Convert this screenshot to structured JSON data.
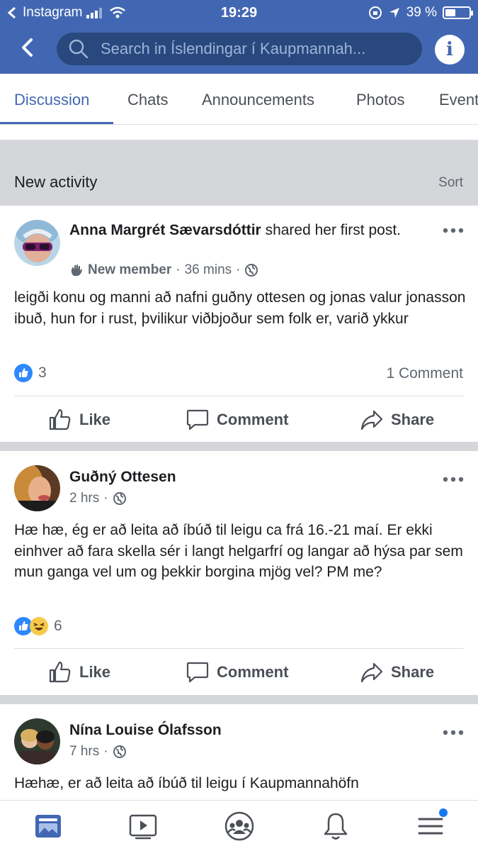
{
  "status_bar": {
    "carrier": "Instagram",
    "time": "19:29",
    "battery": "39 %"
  },
  "header": {
    "search_prefix": "Search in ",
    "search_group": "Íslendingar í Kaupmannah..."
  },
  "tabs": [
    {
      "label": "Discussion",
      "active": true
    },
    {
      "label": "Chats"
    },
    {
      "label": "Announcements"
    },
    {
      "label": "Photos"
    },
    {
      "label": "Event"
    }
  ],
  "activity": {
    "title": "New activity",
    "sort": "Sort"
  },
  "posts": [
    {
      "author": "Anna Margrét Sævarsdóttir",
      "action": " shared her first post.",
      "badge": "New member",
      "time": "36 mins",
      "text": "leigði konu og manni að nafni guðny ottesen og jonas valur jonasson ibuð, hun for i rust, þvilikur viðbjoður sem folk er, varið ykkur",
      "reactions": "3",
      "comments": "1 Comment"
    },
    {
      "author": "Guðný Ottesen",
      "time": "2 hrs",
      "text": "Hæ hæ, ég er að leita að íbúð til leigu ca frá 16.-21 maí. Er ekki einhver að fara skella sér i langt helgarfrí og langar að hýsa par sem mun ganga vel um og þekkir borgina mjög vel? PM me?",
      "reactions": "6"
    },
    {
      "author": "Nína Louise Ólafsson",
      "time": "7 hrs",
      "text": "Hæhæ, er að leita að íbúð til leigu í Kaupmannahöfn"
    }
  ],
  "actions": {
    "like": "Like",
    "comment": "Comment",
    "share": "Share"
  },
  "colors": {
    "brand": "#4267b2",
    "search_bg": "#29487d",
    "like_blue": "#2d88ff",
    "notification_dot": "#1877f2"
  }
}
